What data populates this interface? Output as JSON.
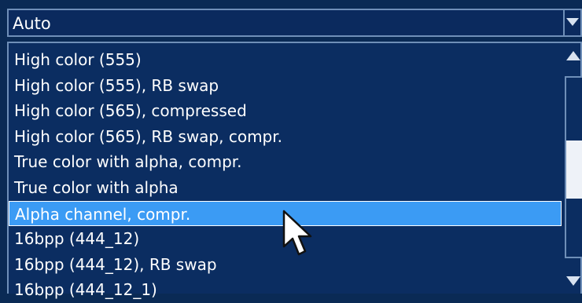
{
  "dropdown": {
    "selected_value": "Auto"
  },
  "list": {
    "items": [
      "High color (555)",
      "High color (555), RB swap",
      "High color (565), compressed",
      "High color (565), RB swap, compr.",
      "True color with alpha, compr.",
      "True color with alpha",
      "Alpha channel, compr.",
      "16bpp (444_12)",
      "16bpp (444_12), RB swap",
      "16bpp (444_12_1)"
    ],
    "highlighted_index": 6
  },
  "icons": {
    "dropdown_arrow": "chevron-down-icon",
    "scroll_up": "scroll-up-arrow-icon",
    "scroll_down": "scroll-down-arrow-icon",
    "cursor": "mouse-pointer-icon"
  },
  "colors": {
    "background": "#0b2d61",
    "highlight": "#3b9bf4",
    "text": "#ffffff",
    "border": "#6f8fb8"
  }
}
